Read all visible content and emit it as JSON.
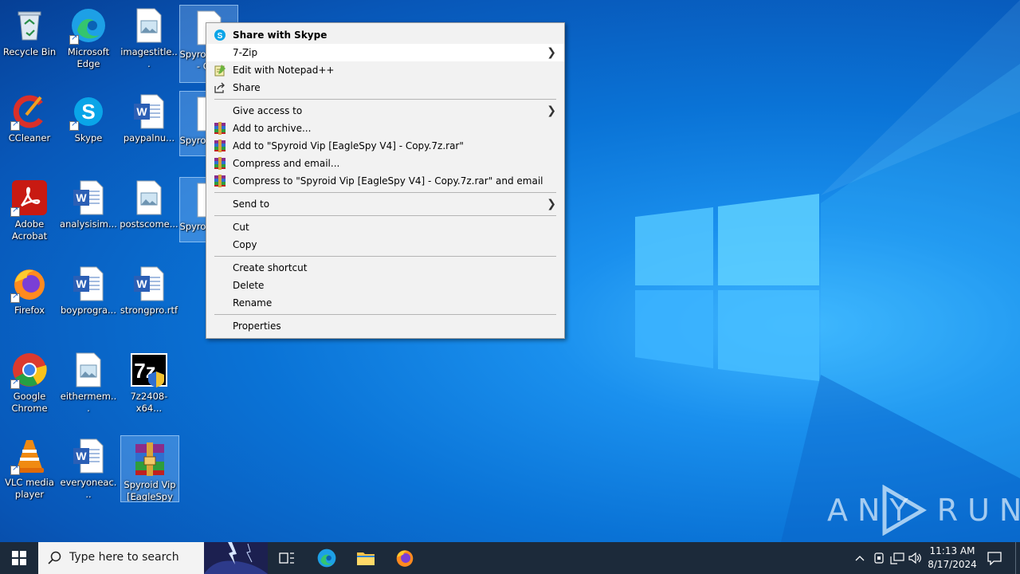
{
  "desktop": {
    "icons": [
      {
        "label": "Recycle Bin",
        "icon": "recycle-bin-icon"
      },
      {
        "label": "Microsoft Edge",
        "icon": "edge-icon"
      },
      {
        "label": "imagestitle...",
        "icon": "image-file-icon"
      },
      {
        "label": "Spyro [Eagle - Cop",
        "icon": "file-icon"
      },
      {
        "label": "CCleaner",
        "icon": "ccleaner-icon"
      },
      {
        "label": "Skype",
        "icon": "skype-icon"
      },
      {
        "label": "paypalnu...",
        "icon": "word-doc-icon"
      },
      {
        "label": "Spyro [Eagle",
        "icon": "file-icon"
      },
      {
        "label": "Adobe Acrobat",
        "icon": "acrobat-icon"
      },
      {
        "label": "analysisim...",
        "icon": "word-doc-icon"
      },
      {
        "label": "postscome...",
        "icon": "image-file-icon"
      },
      {
        "label": "Spyro [Eagle",
        "icon": "file-icon"
      },
      {
        "label": "Firefox",
        "icon": "firefox-icon"
      },
      {
        "label": "boyprogra...",
        "icon": "word-doc-icon"
      },
      {
        "label": "strongpro.rtf",
        "icon": "word-doc-icon"
      },
      {
        "label": "Google Chrome",
        "icon": "chrome-icon"
      },
      {
        "label": "eithermem...",
        "icon": "image-file-icon"
      },
      {
        "label": "7z2408-x64...",
        "icon": "7zip-installer-icon"
      },
      {
        "label": "VLC media player",
        "icon": "vlc-icon"
      },
      {
        "label": "everyoneac...",
        "icon": "word-doc-icon"
      },
      {
        "label": "Spyroid Vip [EagleSpy V...",
        "icon": "winrar-archive-icon"
      }
    ],
    "watermark": "ANY RUN"
  },
  "context_menu": {
    "items": [
      {
        "label": "Share with Skype",
        "icon": "skype-icon"
      },
      {
        "label": "7-Zip",
        "submenu": true
      },
      {
        "label": "Edit with Notepad++",
        "icon": "notepadpp-icon"
      },
      {
        "label": "Share",
        "icon": "share-icon"
      },
      {
        "label": "Give access to",
        "submenu": true
      },
      {
        "label": "Add to archive...",
        "icon": "winrar-icon"
      },
      {
        "label": "Add to \"Spyroid Vip [EagleSpy V4] - Copy.7z.rar\"",
        "icon": "winrar-icon"
      },
      {
        "label": "Compress and email...",
        "icon": "winrar-icon"
      },
      {
        "label": "Compress to \"Spyroid Vip [EagleSpy V4] - Copy.7z.rar\" and email",
        "icon": "winrar-icon"
      },
      {
        "label": "Send to",
        "submenu": true
      },
      {
        "label": "Cut"
      },
      {
        "label": "Copy"
      },
      {
        "label": "Create shortcut"
      },
      {
        "label": "Delete"
      },
      {
        "label": "Rename"
      },
      {
        "label": "Properties"
      }
    ]
  },
  "taskbar": {
    "search_placeholder": "Type here to search",
    "time": "11:13 AM",
    "date": "8/17/2024"
  },
  "colors": {
    "accent": "#0078d7",
    "taskbar": "#1c2a3a",
    "menu_bg": "#f2f2f2"
  }
}
